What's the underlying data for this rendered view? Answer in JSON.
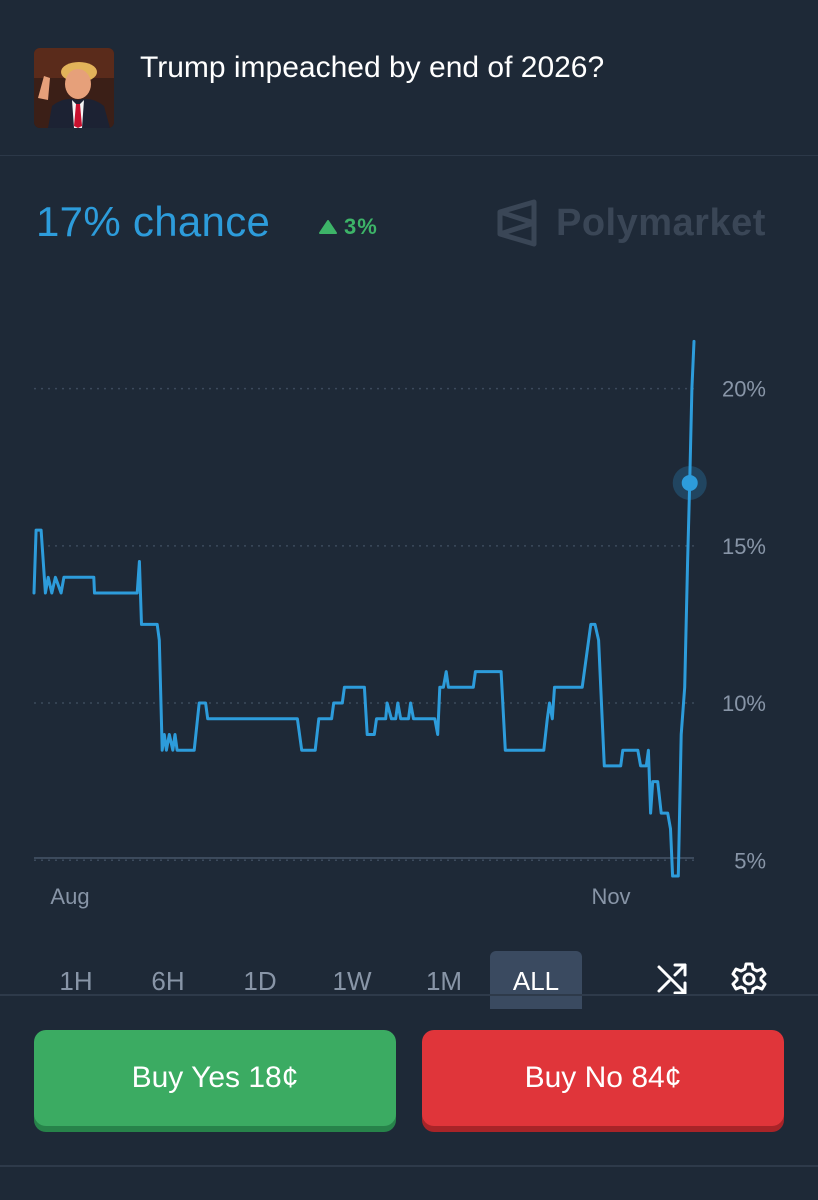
{
  "market": {
    "title": "Trump impeached by end of 2026?",
    "chance_text": "17% chance",
    "change_text": "3%",
    "brand": "Polymarket"
  },
  "chart_data": {
    "type": "line",
    "title": "",
    "xlabel": "",
    "ylabel": "",
    "x_tick_labels": [
      "Aug",
      "Nov"
    ],
    "y_ticks": [
      5,
      10,
      15,
      20
    ],
    "y_tick_labels": [
      "5%",
      "10%",
      "15%",
      "20%"
    ],
    "ylim": [
      3.1,
      22.5
    ],
    "grid": "horizontal-dotted",
    "series": [
      {
        "color": "#2d9cdb",
        "current_value": 17,
        "points": [
          [
            0,
            13.5
          ],
          [
            0.3,
            15.5
          ],
          [
            1.0,
            15.5
          ],
          [
            1.6,
            13.5
          ],
          [
            2.0,
            14.0
          ],
          [
            2.5,
            13.5
          ],
          [
            3.0,
            14.0
          ],
          [
            3.8,
            13.5
          ],
          [
            4.2,
            14.0
          ],
          [
            8.4,
            14.0
          ],
          [
            8.5,
            13.5
          ],
          [
            14.5,
            13.5
          ],
          [
            14.8,
            14.5
          ],
          [
            15.1,
            12.5
          ],
          [
            17.3,
            12.5
          ],
          [
            17.6,
            12.0
          ],
          [
            18.0,
            8.5
          ],
          [
            18.3,
            9.0
          ],
          [
            18.6,
            8.5
          ],
          [
            19.0,
            9.0
          ],
          [
            19.5,
            8.5
          ],
          [
            19.8,
            9.0
          ],
          [
            20.1,
            8.5
          ],
          [
            22.5,
            8.5
          ],
          [
            23.2,
            10.0
          ],
          [
            24.1,
            10.0
          ],
          [
            24.4,
            9.5
          ],
          [
            37.0,
            9.5
          ],
          [
            37.6,
            8.5
          ],
          [
            39.5,
            8.5
          ],
          [
            40.0,
            9.5
          ],
          [
            41.8,
            9.5
          ],
          [
            42.1,
            10.0
          ],
          [
            43.3,
            10.0
          ],
          [
            43.6,
            10.5
          ],
          [
            46.4,
            10.5
          ],
          [
            46.8,
            9.0
          ],
          [
            47.8,
            9.0
          ],
          [
            48.1,
            9.5
          ],
          [
            49.4,
            9.5
          ],
          [
            49.6,
            10.0
          ],
          [
            50.2,
            9.5
          ],
          [
            50.8,
            9.5
          ],
          [
            51.1,
            10.0
          ],
          [
            51.5,
            9.5
          ],
          [
            52.6,
            9.5
          ],
          [
            52.9,
            10.0
          ],
          [
            53.3,
            9.5
          ],
          [
            56.3,
            9.5
          ],
          [
            56.7,
            9.0
          ],
          [
            57.0,
            10.5
          ],
          [
            57.5,
            10.5
          ],
          [
            57.9,
            11.0
          ],
          [
            58.2,
            10.5
          ],
          [
            61.7,
            10.5
          ],
          [
            62.0,
            11.0
          ],
          [
            65.6,
            11.0
          ],
          [
            66.2,
            8.5
          ],
          [
            71.6,
            8.5
          ],
          [
            72.1,
            9.5
          ],
          [
            72.4,
            10.0
          ],
          [
            72.8,
            9.5
          ],
          [
            73.1,
            10.5
          ],
          [
            77.0,
            10.5
          ],
          [
            78.2,
            12.5
          ],
          [
            78.8,
            12.5
          ],
          [
            79.3,
            12.0
          ],
          [
            80.1,
            8.0
          ],
          [
            82.4,
            8.0
          ],
          [
            82.7,
            8.5
          ],
          [
            84.8,
            8.5
          ],
          [
            85.2,
            8.0
          ],
          [
            86.0,
            8.0
          ],
          [
            86.3,
            8.5
          ],
          [
            86.6,
            6.5
          ],
          [
            86.9,
            7.5
          ],
          [
            87.6,
            7.5
          ],
          [
            88.1,
            6.5
          ],
          [
            89.0,
            6.5
          ],
          [
            89.4,
            6.0
          ],
          [
            89.7,
            4.5
          ],
          [
            90.5,
            4.5
          ],
          [
            90.9,
            9.0
          ],
          [
            91.4,
            10.5
          ],
          [
            91.8,
            14.5
          ],
          [
            92.1,
            17.0
          ],
          [
            92.4,
            20.0
          ],
          [
            92.7,
            21.5
          ]
        ]
      }
    ]
  },
  "time_ranges": [
    "1H",
    "6H",
    "1D",
    "1W",
    "1M",
    "ALL"
  ],
  "selected_range": "ALL",
  "buttons": {
    "yes_label": "Buy Yes 18¢",
    "no_label": "Buy No 84¢"
  },
  "colors": {
    "background": "#1e2937",
    "accent": "#2d9cdb",
    "positive": "#3db468",
    "yes_button": "#3bab62",
    "no_button": "#e0353a"
  },
  "icons": [
    "market-avatar",
    "triangle-up-icon",
    "polymarket-logo-icon",
    "shuffle-icon",
    "gear-icon"
  ]
}
